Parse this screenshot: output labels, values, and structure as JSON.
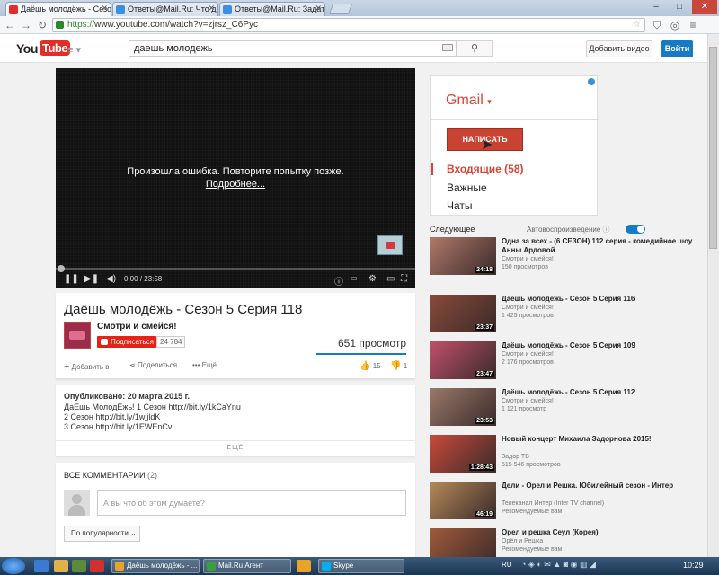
{
  "browser": {
    "tabs": [
      {
        "title": "Даёшь молодёжь - Сезо",
        "active": true,
        "favicon_color": "#e52d27"
      },
      {
        "title": "Ответы@Mail.Ru: Что де",
        "active": false,
        "favicon_color": "#3b8fe0"
      },
      {
        "title": "Ответы@Mail.Ru: Задать",
        "active": false,
        "favicon_color": "#3b8fe0"
      }
    ],
    "url_scheme": "https://",
    "url_rest": "www.youtube.com/watch?v=zjrsz_C6Pyc"
  },
  "youtube": {
    "logo_you": "You",
    "logo_tube": "Tube",
    "search_value": "даешь молодежь",
    "upload_label": "Добавить видео",
    "signin_label": "Войти",
    "brand_color": "#e52d27",
    "accent_color": "#167ac6"
  },
  "player": {
    "error_text": "Произошла ошибка. Повторите попытку позже.",
    "error_more": "Подробнее...",
    "time": "0:00 / 23:58"
  },
  "video": {
    "title": "Даёшь молодёжь - Сезон 5 Серия 118",
    "channel": "Смотри и смейся!",
    "subscribe_label": "Подписаться",
    "subscriber_count": "24 784",
    "views": "651 просмотр",
    "add_to": "Добавить в",
    "share": "Поделиться",
    "more": "Ещё",
    "likes": "15",
    "dislikes": "1"
  },
  "description": {
    "published": "Опубликовано: 20 марта 2015 г.",
    "lines": [
      "ДаЁшь МолодЁжь! 1 Сезон http://bit.ly/1kCaYnu",
      "2 Сезон http://bit.ly/1wjjldK",
      "3 Сезон http://bit.ly/1EWEnCv"
    ],
    "more_label": "ЕЩЁ"
  },
  "comments": {
    "title": "ВСЕ КОММЕНТАРИИ",
    "count": "(2)",
    "placeholder": "А вы что об этом думаете?",
    "sort_label": "По популярности"
  },
  "ad": {
    "gmail_label": "Gmail",
    "compose_label": "НАПИСАТЬ",
    "inbox_label": "Входящие (58)",
    "important_label": "Важные",
    "chats_label": "Чаты"
  },
  "sidebar": {
    "up_next": "Следующее",
    "autoplay": "Автовоспроизведение",
    "videos": [
      {
        "title": "Одна за всех - (6 СЕЗОН) 112 серия - комедийное шоу Анны Ардовой",
        "channel": "Смотри и смейся!",
        "views": "150 просмотров",
        "duration": "24:18",
        "thumb": "#b07a6a"
      },
      {
        "title": "Даёшь молодёжь - Сезон 5 Серия 116",
        "channel": "Смотри и смейся!",
        "views": "1 425 просмотров",
        "duration": "23:37",
        "thumb": "#8a4a3a"
      },
      {
        "title": "Даёшь молодёжь - Сезон 5 Серия 109",
        "channel": "Смотри и смейся!",
        "views": "2 176 просмотров",
        "duration": "23:47",
        "thumb": "#c0506a"
      },
      {
        "title": "Даёшь молодёжь - Сезон 5 Серия 112",
        "channel": "Смотри и смейся!",
        "views": "1 121 просмотр",
        "duration": "23:53",
        "thumb": "#9a7a6a"
      },
      {
        "title": "Новый концерт Михаила Задорнова 2015!",
        "channel": "Задор ТВ",
        "views": "515 546 просмотров",
        "duration": "1:28:43",
        "thumb": "#c94a3a"
      },
      {
        "title": "Дели - Орел и Решка. Юбилейный сезон - Интер",
        "channel": "Телеканал Интер (Inter TV channel)",
        "views": "Рекомендуемые вам",
        "duration": "46:19",
        "thumb": "#b58a5a"
      },
      {
        "title": "Орел и решка Сеул (Корея)",
        "channel": "Орёл и Решка",
        "views": "Рекомендуемые вам",
        "duration": "",
        "thumb": "#a05a3a"
      }
    ]
  },
  "taskbar": {
    "tasks": [
      "Даёшь молодёжь - ...",
      "Mail.Ru Агент",
      "Skype"
    ],
    "lang": "RU",
    "clock": "10:29"
  }
}
